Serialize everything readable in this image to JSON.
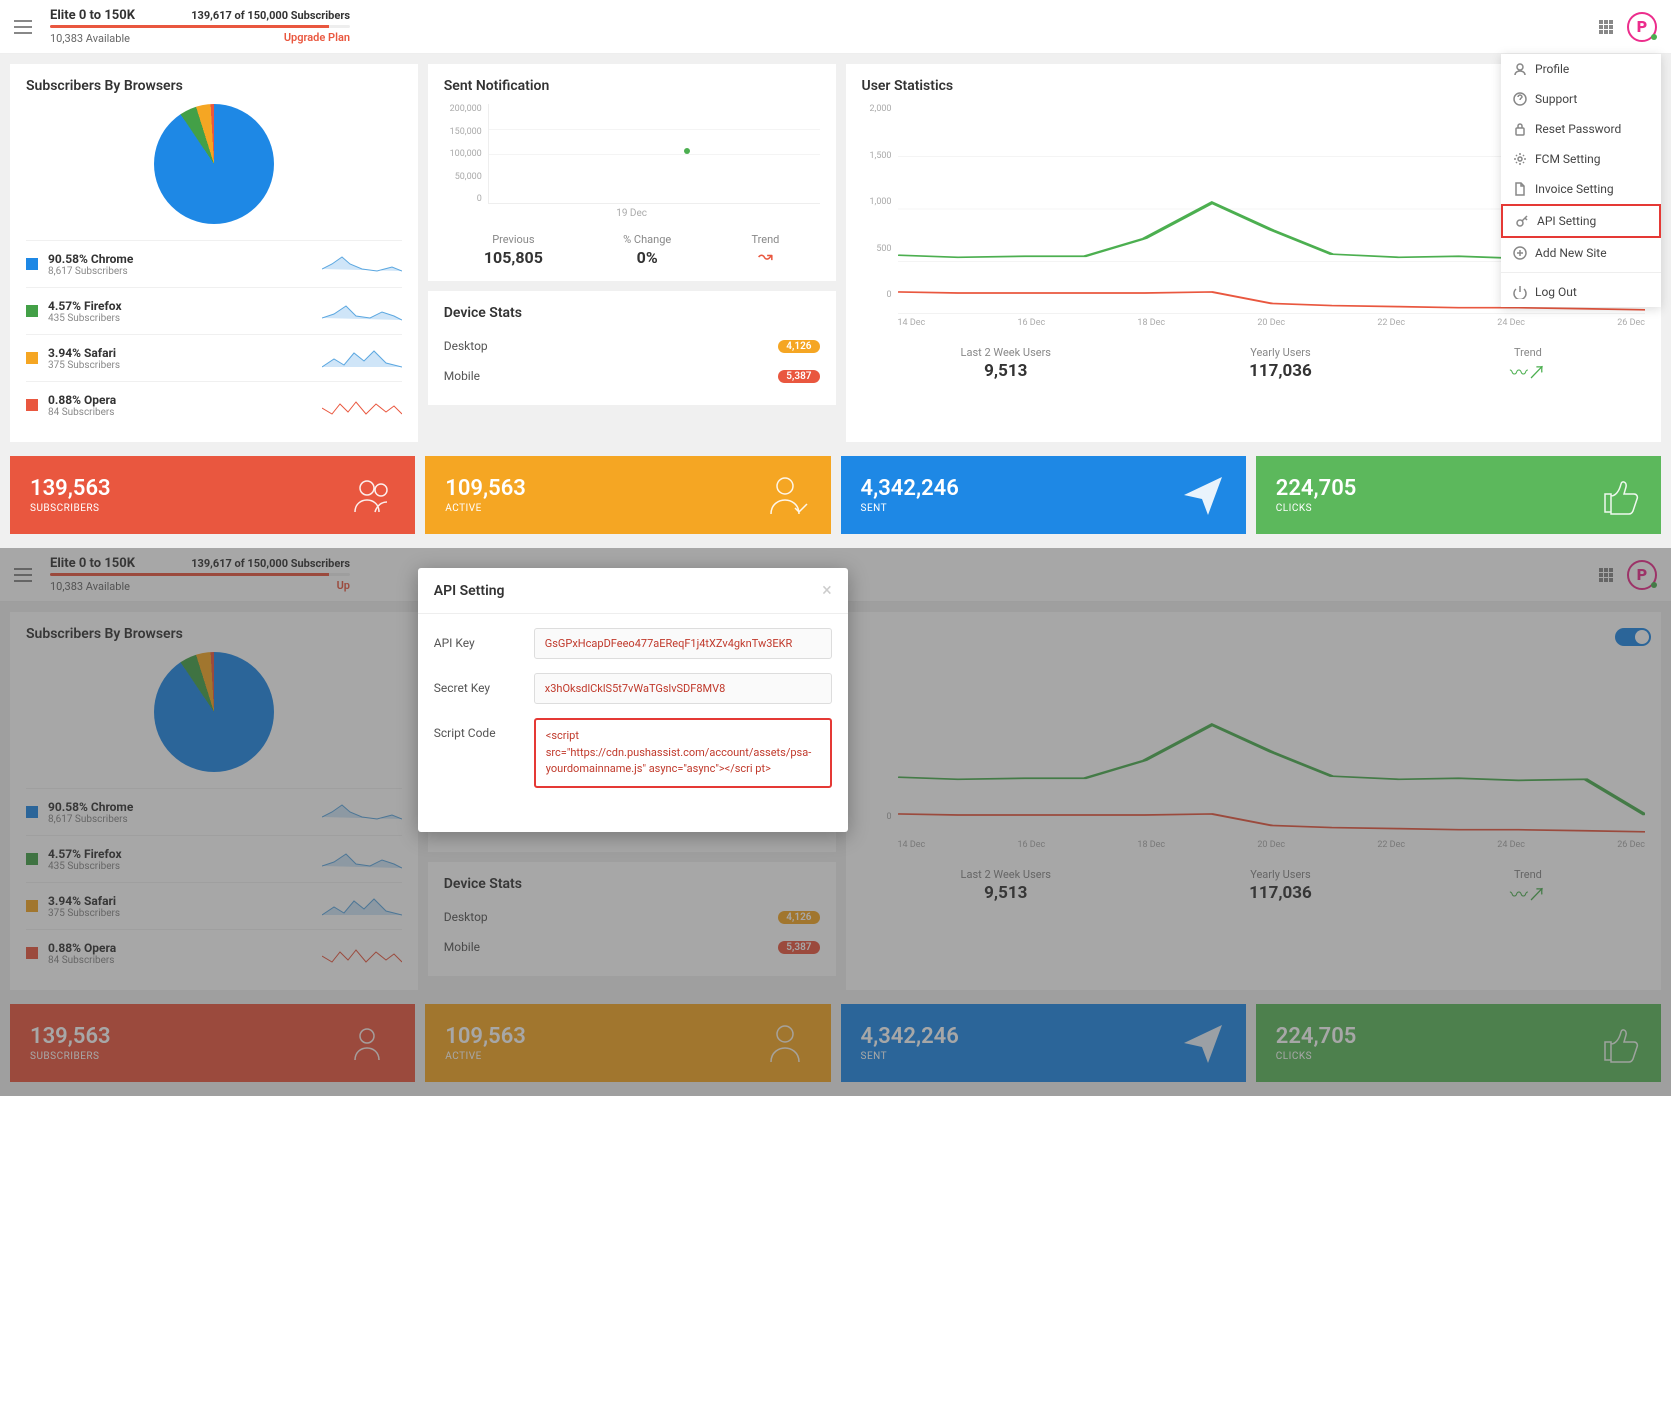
{
  "topbar": {
    "plan_title": "Elite 0 to 150K",
    "subscribers_text": "139,617 of 150,000 Subscribers",
    "available_text": "10,383 Available",
    "upgrade_text": "Upgrade Plan"
  },
  "dropdown": {
    "items": [
      {
        "label": "Profile",
        "icon": "user"
      },
      {
        "label": "Support",
        "icon": "help"
      },
      {
        "label": "Reset Password",
        "icon": "lock"
      },
      {
        "label": "FCM Setting",
        "icon": "gear"
      },
      {
        "label": "Invoice Setting",
        "icon": "file"
      },
      {
        "label": "API Setting",
        "icon": "key",
        "highlighted": true
      },
      {
        "label": "Add New Site",
        "icon": "plus"
      },
      {
        "label": "Log Out",
        "icon": "power",
        "separated": true
      }
    ]
  },
  "browsers": {
    "title": "Subscribers By Browsers",
    "items": [
      {
        "pct": "90.58% Chrome",
        "subs": "8,617 Subscribers",
        "color": "#1e88e5"
      },
      {
        "pct": "4.57% Firefox",
        "subs": "435 Subscribers",
        "color": "#43a047"
      },
      {
        "pct": "3.94% Safari",
        "subs": "375 Subscribers",
        "color": "#f5a623"
      },
      {
        "pct": "0.88% Opera",
        "subs": "84 Subscribers",
        "color": "#e9573f"
      }
    ]
  },
  "notification": {
    "title": "Sent Notification",
    "yticks": [
      "200,000",
      "150,000",
      "100,000",
      "50,000",
      "0"
    ],
    "xlabel": "19 Dec",
    "previous_label": "Previous",
    "previous_value": "105,805",
    "change_label": "% Change",
    "change_value": "0%",
    "trend_label": "Trend"
  },
  "devices": {
    "title": "Device Stats",
    "rows": [
      {
        "label": "Desktop",
        "badge": "4,126",
        "cls": "badge-orange"
      },
      {
        "label": "Mobile",
        "badge": "5,387",
        "cls": "badge-red"
      }
    ]
  },
  "userstats": {
    "title": "User Statistics",
    "yticks": [
      "2,000",
      "1,500",
      "1,000",
      "500",
      "0"
    ],
    "xticks": [
      "14 Dec",
      "16 Dec",
      "18 Dec",
      "20 Dec",
      "22 Dec",
      "24 Dec",
      "26 Dec"
    ],
    "last2_label": "Last 2 Week Users",
    "last2_value": "9,513",
    "yearly_label": "Yearly Users",
    "yearly_value": "117,036",
    "trend_label": "Trend"
  },
  "kpis": [
    {
      "num": "139,563",
      "lbl": "SUBSCRIBERS",
      "cls": "kpi-orange",
      "icon": "users"
    },
    {
      "num": "109,563",
      "lbl": "ACTIVE",
      "cls": "kpi-yellow",
      "icon": "user-check"
    },
    {
      "num": "4,342,246",
      "lbl": "SENT",
      "cls": "kpi-blue",
      "icon": "send"
    },
    {
      "num": "224,705",
      "lbl": "CLICKS",
      "cls": "kpi-green",
      "icon": "thumb"
    }
  ],
  "modal": {
    "title": "API Setting",
    "api_key_label": "API Key",
    "api_key_value": "GsGPxHcapDFeeo477aEReqF1j4tXZv4gknTw3EKR",
    "secret_label": "Secret Key",
    "secret_value": "x3hOksdlCklS5t7vWaTGslvSDF8MV8",
    "script_label": "Script Code",
    "script_value": "<script src=\"https://cdn.pushassist.com/account/assets/psa-yourdomainname.js\" async=\"async\"></scri pt>"
  },
  "chart_data": [
    {
      "type": "pie",
      "title": "Subscribers By Browsers",
      "categories": [
        "Chrome",
        "Firefox",
        "Safari",
        "Opera"
      ],
      "values": [
        90.58,
        4.57,
        3.94,
        0.88
      ],
      "colors": [
        "#1e88e5",
        "#43a047",
        "#f5a623",
        "#e9573f"
      ]
    },
    {
      "type": "scatter",
      "title": "Sent Notification",
      "x": [
        "19 Dec"
      ],
      "values": [
        105805
      ],
      "ylim": [
        0,
        200000
      ]
    },
    {
      "type": "line",
      "title": "User Statistics",
      "x": [
        "14 Dec",
        "15 Dec",
        "16 Dec",
        "17 Dec",
        "18 Dec",
        "19 Dec",
        "20 Dec",
        "21 Dec",
        "22 Dec",
        "23 Dec",
        "24 Dec",
        "25 Dec",
        "26 Dec"
      ],
      "series": [
        {
          "name": "green",
          "values": [
            560,
            540,
            550,
            550,
            720,
            1060,
            800,
            570,
            540,
            550,
            530,
            540,
            200
          ],
          "color": "#4caf50"
        },
        {
          "name": "orange",
          "values": [
            210,
            200,
            200,
            200,
            200,
            210,
            100,
            80,
            70,
            60,
            60,
            50,
            40
          ],
          "color": "#e9573f"
        }
      ],
      "ylim": [
        0,
        2000
      ]
    }
  ]
}
